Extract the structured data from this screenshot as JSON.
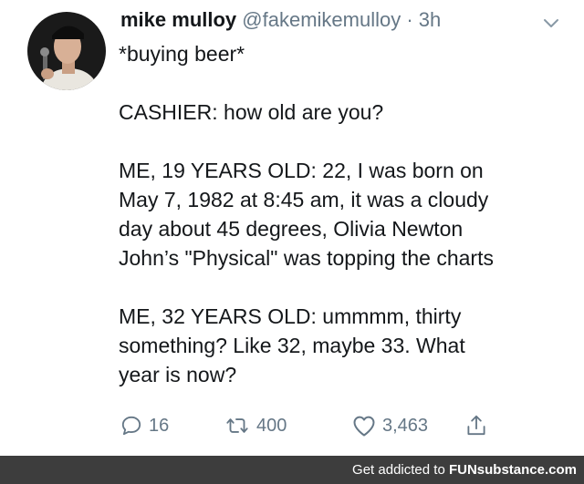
{
  "tweet": {
    "author_name": "mike mulloy",
    "handle": "@fakemikemulloy",
    "separator": "·",
    "time": "3h",
    "paragraphs": [
      "*buying beer*",
      "CASHIER: how old are you?",
      "ME, 19 YEARS OLD: 22, I was born on\nMay 7, 1982 at 8:45 am, it was a cloudy\nday about 45 degrees, Olivia Newton\nJohn’s \"Physical\" was topping the charts",
      "ME, 32 YEARS OLD: ummmm, thirty\nsomething? Like 32, maybe 33. What\nyear is now?"
    ],
    "replies": "16",
    "retweets": "400",
    "likes": "3,463"
  },
  "icons": {
    "avatar": "profile-photo",
    "menu": "chevron-down-icon",
    "reply": "comment-icon",
    "retweet": "retweet-icon",
    "like": "heart-icon",
    "share": "share-icon"
  },
  "colors": {
    "text": "#14171a",
    "muted": "#657786",
    "footer_bg": "#3d3d3d"
  },
  "footer": {
    "text": "Get addicted to ",
    "brand": "FUNsubstance.com"
  }
}
